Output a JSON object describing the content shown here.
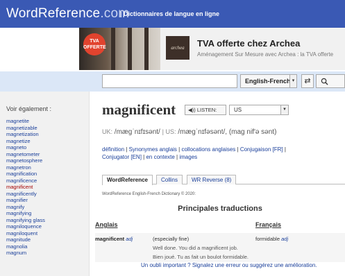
{
  "header": {
    "logo_main": "WordReference",
    "logo_ext": ".com",
    "tagline": "| Dictionnaires de langue en ligne"
  },
  "ad": {
    "badge": "TVA OFFERTE",
    "brand": "archea",
    "title": "TVA offerte chez Archea",
    "subtitle": "Aménagement Sur Mesure avec Archea : la TVA offerte"
  },
  "search": {
    "input_value": "",
    "language": "English-French",
    "swap_icon": "swap-arrows-icon",
    "search_icon": "search-icon"
  },
  "sidebar": {
    "title": "Voir également :",
    "items": [
      "magnetite",
      "magnetizable",
      "magnetization",
      "magnetize",
      "magneto",
      "magnetometer",
      "magnetosphere",
      "magnetron",
      "magnification",
      "magnificence",
      "magnificent",
      "magnificently",
      "magnifier",
      "magnify",
      "magnifying",
      "magnifying glass",
      "magniloquence",
      "magniloquent",
      "magnitude",
      "magnolia",
      "magnum"
    ],
    "active_index": 10
  },
  "entry": {
    "headword": "magnificent",
    "listen_label": "LISTEN:",
    "accent": "US",
    "pron_uk_label": "UK:",
    "pron_uk": "/mæɡˈnɪfɪsənt/",
    "pron_us_label": "US:",
    "pron_us": "/mæɡˈnɪfəsənt/, (mag nif′ə sənt)"
  },
  "links": {
    "definition": "définition",
    "synonyms": "Synonymes anglais",
    "collocations": "collocations anglaises",
    "conjugation_fr": "Conjugaison [FR]",
    "conjugator_en": "Conjugator [EN]",
    "context": "en contexte",
    "images": "images"
  },
  "tabs": [
    {
      "label": "WordReference"
    },
    {
      "label": "Collins"
    },
    {
      "label": "WR Reverse (8)"
    }
  ],
  "dictionary_credit": "WordReference English-French Dictionary © 2020:",
  "translations": {
    "section_title": "Principales traductions",
    "col_en": "Anglais",
    "col_fr": "Français",
    "rows": [
      {
        "word": "magnificent",
        "pos": "adj",
        "sense": "(especially fine)",
        "translation": "formidable",
        "translation_pos": "adj",
        "example_en": "Well done. You did a magnificent job.",
        "example_fr": "Bien joué. Tu as fait un boulot formidable."
      }
    ]
  },
  "report_text": "Un oubli important ? Signalez une erreur ou suggérez une amélioration."
}
